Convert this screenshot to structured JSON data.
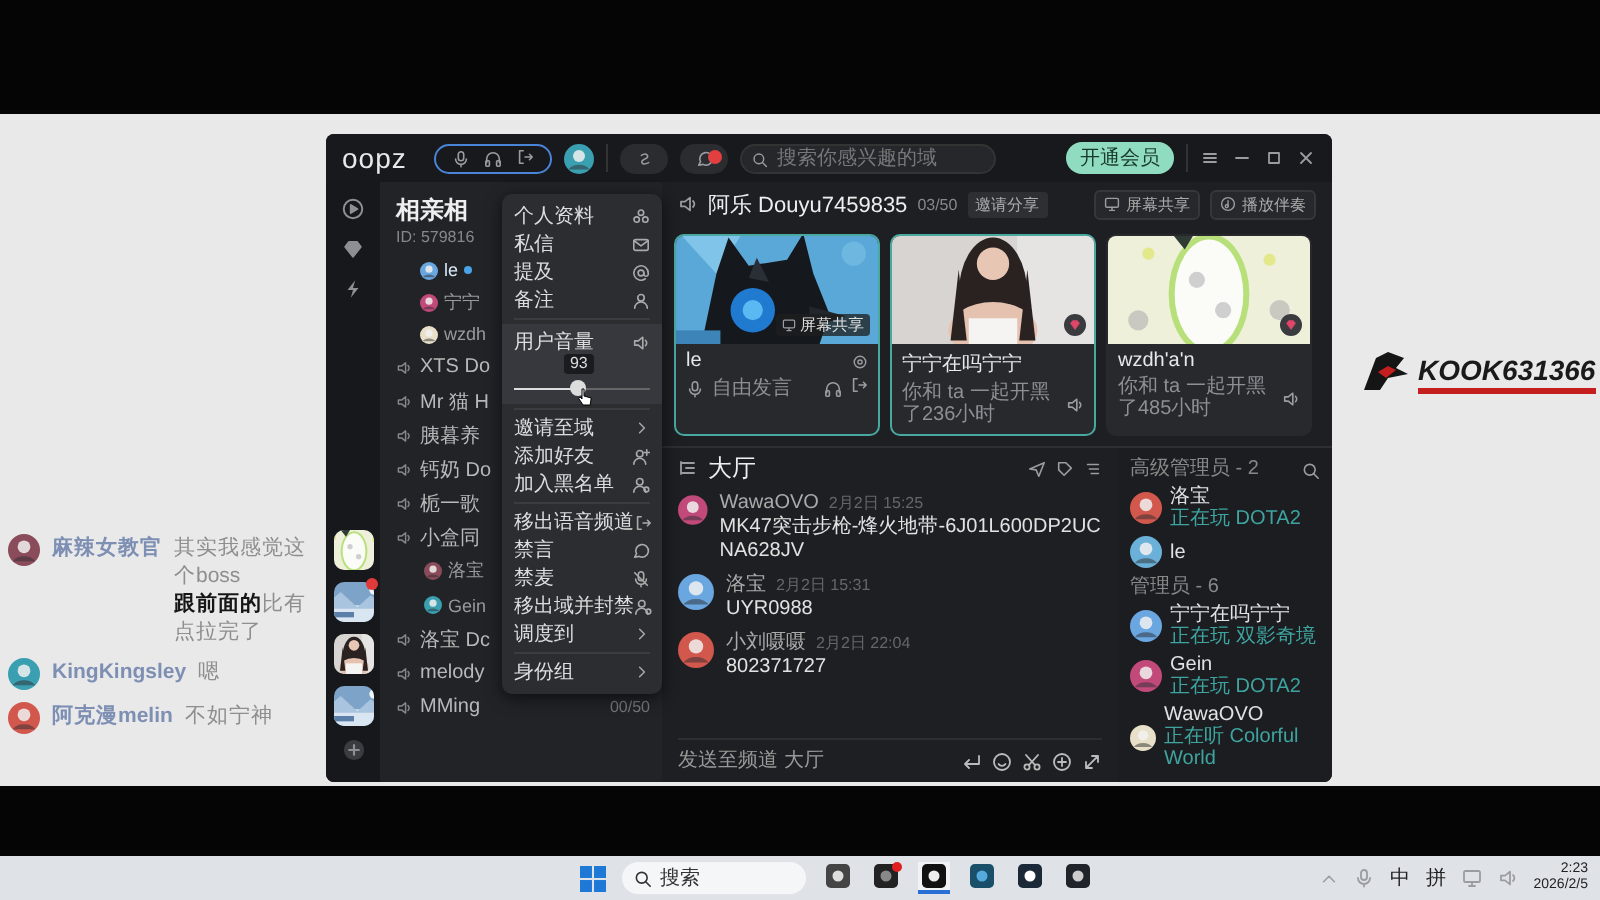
{
  "title_bar": {
    "logo": "oopz",
    "unread": true,
    "search": {
      "placeholder": "搜索你感兴趣的域"
    },
    "vip_button": "开通会员"
  },
  "rail": {
    "servers": [
      {
        "unread": false
      },
      {
        "unread": true
      },
      {
        "unread": false
      },
      {
        "unread": false
      }
    ]
  },
  "channel_panel": {
    "title": "相亲相",
    "id": "ID: 579816",
    "voice_members": [
      {
        "name": "le",
        "speaking": true
      },
      {
        "name": "宁宁",
        "speaking": false
      },
      {
        "name": "wzdh",
        "speaking": false
      }
    ],
    "channels": [
      {
        "name": "XTS Do"
      },
      {
        "name": "Mr 猫 H"
      },
      {
        "name": "胰暮养"
      },
      {
        "name": "钙奶 Do"
      },
      {
        "name": "栀一歌"
      },
      {
        "name": "小盒同",
        "children": [
          {
            "name": "洛宝"
          },
          {
            "name": "Gein"
          }
        ]
      },
      {
        "name": "洛宝 Dc"
      },
      {
        "name": "melody"
      },
      {
        "name": "MMing",
        "count": "00/50"
      }
    ]
  },
  "context_menu": {
    "sections": [
      [
        {
          "label": "个人资料",
          "kind": "action"
        },
        {
          "label": "私信",
          "kind": "action"
        },
        {
          "label": "提及",
          "kind": "action"
        },
        {
          "label": "备注",
          "kind": "action"
        }
      ],
      [
        {
          "label": "用户音量",
          "kind": "volume",
          "level": 0.47,
          "reading": "93"
        }
      ],
      [
        {
          "label": "邀请至域",
          "kind": "submenu"
        },
        {
          "label": "添加好友",
          "kind": "action"
        },
        {
          "label": "加入黑名单",
          "kind": "action"
        }
      ],
      [
        {
          "label": "移出语音频道",
          "kind": "action"
        },
        {
          "label": "禁言",
          "kind": "action"
        },
        {
          "label": "禁麦",
          "kind": "action"
        },
        {
          "label": "移出域并封禁",
          "kind": "action"
        },
        {
          "label": "调度到",
          "kind": "submenu"
        }
      ],
      [
        {
          "label": "身份组",
          "kind": "submenu"
        }
      ]
    ]
  },
  "room": {
    "name": "阿乐 Douyu7459835",
    "count": "03/50",
    "invite_button": "邀请分享",
    "buttons": [
      "屏幕共享",
      "播放伴奏"
    ],
    "cards": [
      {
        "name": "le",
        "status": "自由发言",
        "badge": "屏幕共享",
        "speaking": true,
        "kind": "self"
      },
      {
        "name": "宁宁在吗宁宁",
        "status": "你和 ta 一起开黑了236小时",
        "speaking": true,
        "kind": "other"
      },
      {
        "name": "wzdh'a'n",
        "status": "你和 ta 一起开黑了485小时",
        "speaking": false,
        "kind": "other"
      }
    ]
  },
  "chat": {
    "title": "大厅",
    "messages": [
      {
        "user": "WawaOVO",
        "time": "2月2日 15:25",
        "text": "MK47突击步枪-烽火地带-6J01L600DP2UCNA628JV"
      },
      {
        "user": "洛宝",
        "time": "2月2日 15:31",
        "text": "UYR0988"
      },
      {
        "user": "小刘嗫嗫",
        "time": "2月2日 22:04",
        "text": "802371727"
      }
    ],
    "input": {
      "placeholder": "发送至频道 大厅"
    }
  },
  "members": {
    "groups": [
      {
        "title": "高级管理员 - 2",
        "members": [
          {
            "name": "洛宝",
            "activity": "正在玩 DOTA2"
          },
          {
            "name": "le"
          }
        ]
      },
      {
        "title": "管理员 - 6",
        "members": [
          {
            "name": "宁宁在吗宁宁",
            "activity": "正在玩 双影奇境"
          },
          {
            "name": "Gein",
            "activity": "正在玩 DOTA2"
          },
          {
            "name": "WawaOVO",
            "activity": "正在听 Colorful World"
          }
        ]
      }
    ]
  },
  "stream_chat": [
    {
      "user": "麻辣女教官",
      "text": "其实我感觉这个boss**跟前面的**比有点拉完了"
    },
    {
      "user": "KingKingsley",
      "text": "嗯"
    },
    {
      "user": "阿克漫melin",
      "text": "不如宁神"
    }
  ],
  "stream_logo": {
    "text": "KOOK631366"
  },
  "taskbar": {
    "search": {
      "placeholder": "搜索"
    },
    "apps": [
      {
        "badge": false,
        "active": false
      },
      {
        "badge": true,
        "active": false
      },
      {
        "badge": false,
        "active": true
      },
      {
        "badge": false,
        "active": false
      },
      {
        "badge": false,
        "active": false
      },
      {
        "badge": false,
        "active": false
      }
    ],
    "ime": "中",
    "ime_mode": "拼",
    "time": "2:23",
    "date": "2026/2/5"
  }
}
